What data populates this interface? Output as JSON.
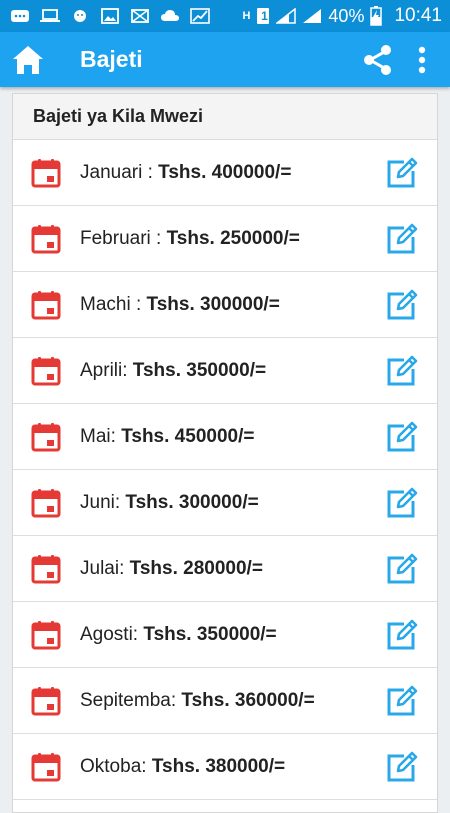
{
  "status_bar": {
    "battery": "40%",
    "time": "10:41",
    "sim_label": "1",
    "network_label": "H"
  },
  "appbar": {
    "title": "Bajeti"
  },
  "card": {
    "title": "Bajeti ya Kila Mwezi",
    "items": [
      {
        "month": "Januari : ",
        "amount": "Tshs. 400000/="
      },
      {
        "month": "Februari : ",
        "amount": "Tshs. 250000/="
      },
      {
        "month": "Machi : ",
        "amount": "Tshs. 300000/="
      },
      {
        "month": "Aprili: ",
        "amount": "Tshs. 350000/="
      },
      {
        "month": "Mai: ",
        "amount": "Tshs. 450000/="
      },
      {
        "month": "Juni: ",
        "amount": "Tshs. 300000/="
      },
      {
        "month": "Julai: ",
        "amount": "Tshs. 280000/="
      },
      {
        "month": "Agosti: ",
        "amount": "Tshs. 350000/="
      },
      {
        "month": "Sepitemba: ",
        "amount": "Tshs. 360000/="
      },
      {
        "month": "Oktoba: ",
        "amount": "Tshs. 380000/="
      }
    ]
  },
  "colors": {
    "status_bar": "#0d8fd8",
    "app_bar": "#1ea3f0",
    "calendar_icon": "#e53935",
    "edit_icon": "#29a8e8"
  },
  "icons": {
    "home": "home-icon",
    "share": "share-icon",
    "more": "more-vert-icon",
    "calendar": "calendar-icon",
    "edit": "edit-icon"
  }
}
